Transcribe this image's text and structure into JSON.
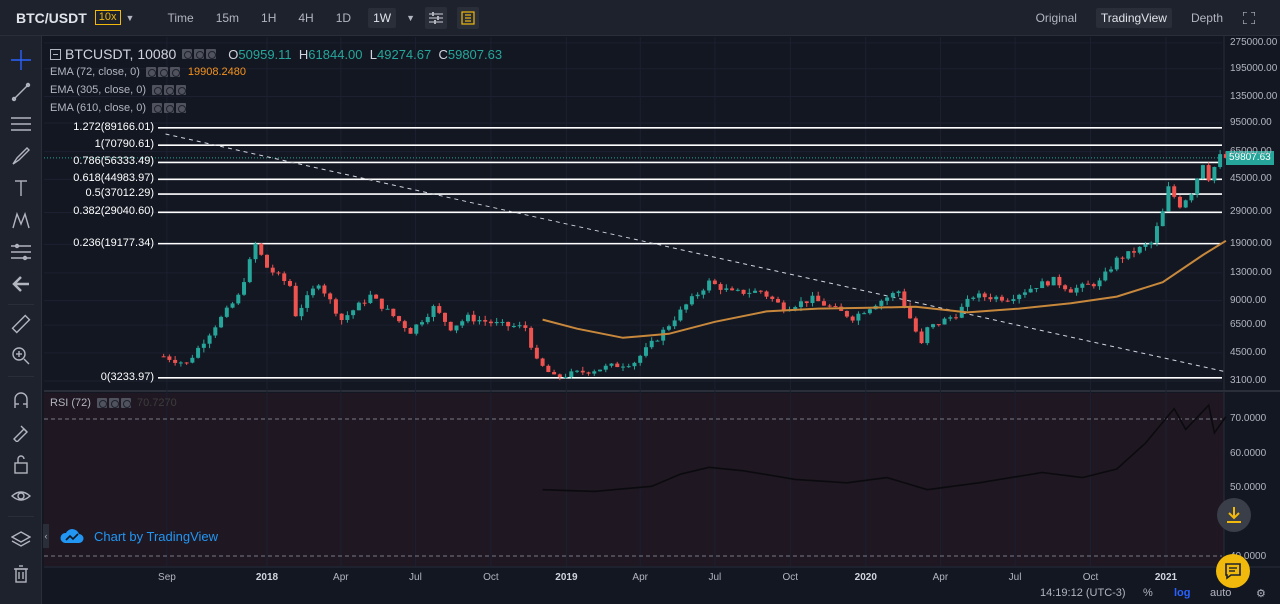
{
  "topbar": {
    "pair": "BTC/USDT",
    "leverage": "10x",
    "timeframes": [
      "Time",
      "15m",
      "1H",
      "4H",
      "1D",
      "1W"
    ],
    "active_timeframe": "1W",
    "view_tabs": [
      "Original",
      "TradingView",
      "Depth"
    ],
    "active_view": "TradingView"
  },
  "legend": {
    "symbol": "BTCUSDT, 10080",
    "open_label": "O",
    "open": "50959.11",
    "high_label": "H",
    "high": "61844.00",
    "low_label": "L",
    "low": "49274.67",
    "close_label": "C",
    "close": "59807.63",
    "indicators": [
      {
        "label": "EMA (72, close, 0)",
        "value": "19908.2480"
      },
      {
        "label": "EMA (305, close, 0)",
        "value": ""
      },
      {
        "label": "EMA (610, close, 0)",
        "value": ""
      }
    ]
  },
  "rsi": {
    "label": "RSI (72)",
    "value": "70.7270"
  },
  "price_tag": "59807.63",
  "attribution": "Chart by TradingView",
  "status": {
    "time": "14:19:12 (UTC-3)",
    "percent": "%",
    "log": "log",
    "auto": "auto"
  },
  "colors": {
    "up": "#26a69a",
    "down": "#ef5350",
    "ema": "#c8883c",
    "background": "#131722",
    "rsi_background": "#1f1722",
    "fib": "#ffffff"
  },
  "chart_data": {
    "type": "candlestick",
    "y_scale": "log",
    "y_ticks": [
      "275000.00",
      "195000.00",
      "135000.00",
      "95000.00",
      "65000.00",
      "45000.00",
      "29000.00",
      "19000.00",
      "13000.00",
      "9000.00",
      "6500.00",
      "4500.00",
      "3100.00"
    ],
    "x_ticks": [
      "Sep",
      "2018",
      "Apr",
      "Jul",
      "Oct",
      "2019",
      "Apr",
      "Jul",
      "Oct",
      "2020",
      "Apr",
      "Jul",
      "Oct",
      "2021"
    ],
    "fib_levels": [
      {
        "label": "1.272(89166.01)",
        "value": 89166.01
      },
      {
        "label": "1(70790.61)",
        "value": 70790.61
      },
      {
        "label": "0.786(56333.49)",
        "value": 56333.49
      },
      {
        "label": "0.618(44983.97)",
        "value": 44983.97
      },
      {
        "label": "0.5(37012.29)",
        "value": 37012.29
      },
      {
        "label": "0.382(29040.60)",
        "value": 29040.6
      },
      {
        "label": "0.236(19177.34)",
        "value": 19177.34
      },
      {
        "label": "0(3233.97)",
        "value": 3233.97
      }
    ],
    "price_path": [
      [
        "2017-08-28",
        4300
      ],
      [
        "2017-09-25",
        3900
      ],
      [
        "2017-10-30",
        6500
      ],
      [
        "2017-11-27",
        9500
      ],
      [
        "2017-12-18",
        19000
      ],
      [
        "2018-01-01",
        14000
      ],
      [
        "2018-01-29",
        11000
      ],
      [
        "2018-02-05",
        7500
      ],
      [
        "2018-03-05",
        11500
      ],
      [
        "2018-04-02",
        7000
      ],
      [
        "2018-05-07",
        9600
      ],
      [
        "2018-06-25",
        6000
      ],
      [
        "2018-07-23",
        8200
      ],
      [
        "2018-08-13",
        6300
      ],
      [
        "2018-09-03",
        7200
      ],
      [
        "2018-10-15",
        6500
      ],
      [
        "2018-11-12",
        6300
      ],
      [
        "2018-11-26",
        4000
      ],
      [
        "2018-12-17",
        3250
      ],
      [
        "2019-01-21",
        3500
      ],
      [
        "2019-03-25",
        4000
      ],
      [
        "2019-04-22",
        5500
      ],
      [
        "2019-05-27",
        8500
      ],
      [
        "2019-06-24",
        11500
      ],
      [
        "2019-07-22",
        10000
      ],
      [
        "2019-08-26",
        10200
      ],
      [
        "2019-09-23",
        8200
      ],
      [
        "2019-10-28",
        9200
      ],
      [
        "2019-12-16",
        7200
      ],
      [
        "2020-01-13",
        8700
      ],
      [
        "2020-02-10",
        10200
      ],
      [
        "2020-03-09",
        5000
      ],
      [
        "2020-03-16",
        6200
      ],
      [
        "2020-04-20",
        7500
      ],
      [
        "2020-05-11",
        9600
      ],
      [
        "2020-06-22",
        9300
      ],
      [
        "2020-07-27",
        11000
      ],
      [
        "2020-08-17",
        11800
      ],
      [
        "2020-09-07",
        10400
      ],
      [
        "2020-10-12",
        11500
      ],
      [
        "2020-11-02",
        15500
      ],
      [
        "2020-12-14",
        19300
      ],
      [
        "2020-12-28",
        29000
      ],
      [
        "2021-01-04",
        40000
      ],
      [
        "2021-01-18",
        32000
      ],
      [
        "2021-02-01",
        38000
      ],
      [
        "2021-02-15",
        56000
      ],
      [
        "2021-02-22",
        46000
      ],
      [
        "2021-03-08",
        61000
      ],
      [
        "2021-03-15",
        59807
      ]
    ],
    "ema72_path": [
      [
        "2018-12-03",
        7000
      ],
      [
        "2019-01-14",
        6200
      ],
      [
        "2019-03-11",
        5500
      ],
      [
        "2019-05-06",
        5800
      ],
      [
        "2019-07-01",
        6800
      ],
      [
        "2019-09-02",
        7800
      ],
      [
        "2019-11-04",
        8100
      ],
      [
        "2020-01-06",
        8200
      ],
      [
        "2020-03-02",
        8300
      ],
      [
        "2020-05-04",
        7700
      ],
      [
        "2020-07-06",
        8100
      ],
      [
        "2020-09-07",
        8700
      ],
      [
        "2020-11-02",
        9500
      ],
      [
        "2020-12-28",
        11500
      ],
      [
        "2021-02-15",
        16500
      ],
      [
        "2021-03-15",
        19908
      ]
    ],
    "rsi_path": [
      [
        "2018-12-03",
        49.5
      ],
      [
        "2019-02-04",
        49
      ],
      [
        "2019-04-15",
        50.5
      ],
      [
        "2019-05-20",
        54
      ],
      [
        "2019-06-24",
        56
      ],
      [
        "2019-08-05",
        55
      ],
      [
        "2019-10-07",
        52.5
      ],
      [
        "2019-12-09",
        51.5
      ],
      [
        "2020-01-27",
        53
      ],
      [
        "2020-03-16",
        49.5
      ],
      [
        "2020-05-18",
        51.5
      ],
      [
        "2020-08-03",
        54.5
      ],
      [
        "2020-09-21",
        53
      ],
      [
        "2020-11-02",
        55.5
      ],
      [
        "2020-12-07",
        63
      ],
      [
        "2020-12-28",
        69
      ],
      [
        "2021-01-11",
        73
      ],
      [
        "2021-01-25",
        67
      ],
      [
        "2021-02-22",
        74
      ],
      [
        "2021-03-01",
        66
      ],
      [
        "2021-03-15",
        70.7
      ]
    ],
    "rsi_ticks": [
      "70.0000",
      "60.0000",
      "50.0000",
      "40.0000"
    ],
    "trendline": {
      "from": [
        "2017-12-18",
        70000
      ],
      "to": [
        "2021-03-15",
        3500
      ]
    }
  }
}
